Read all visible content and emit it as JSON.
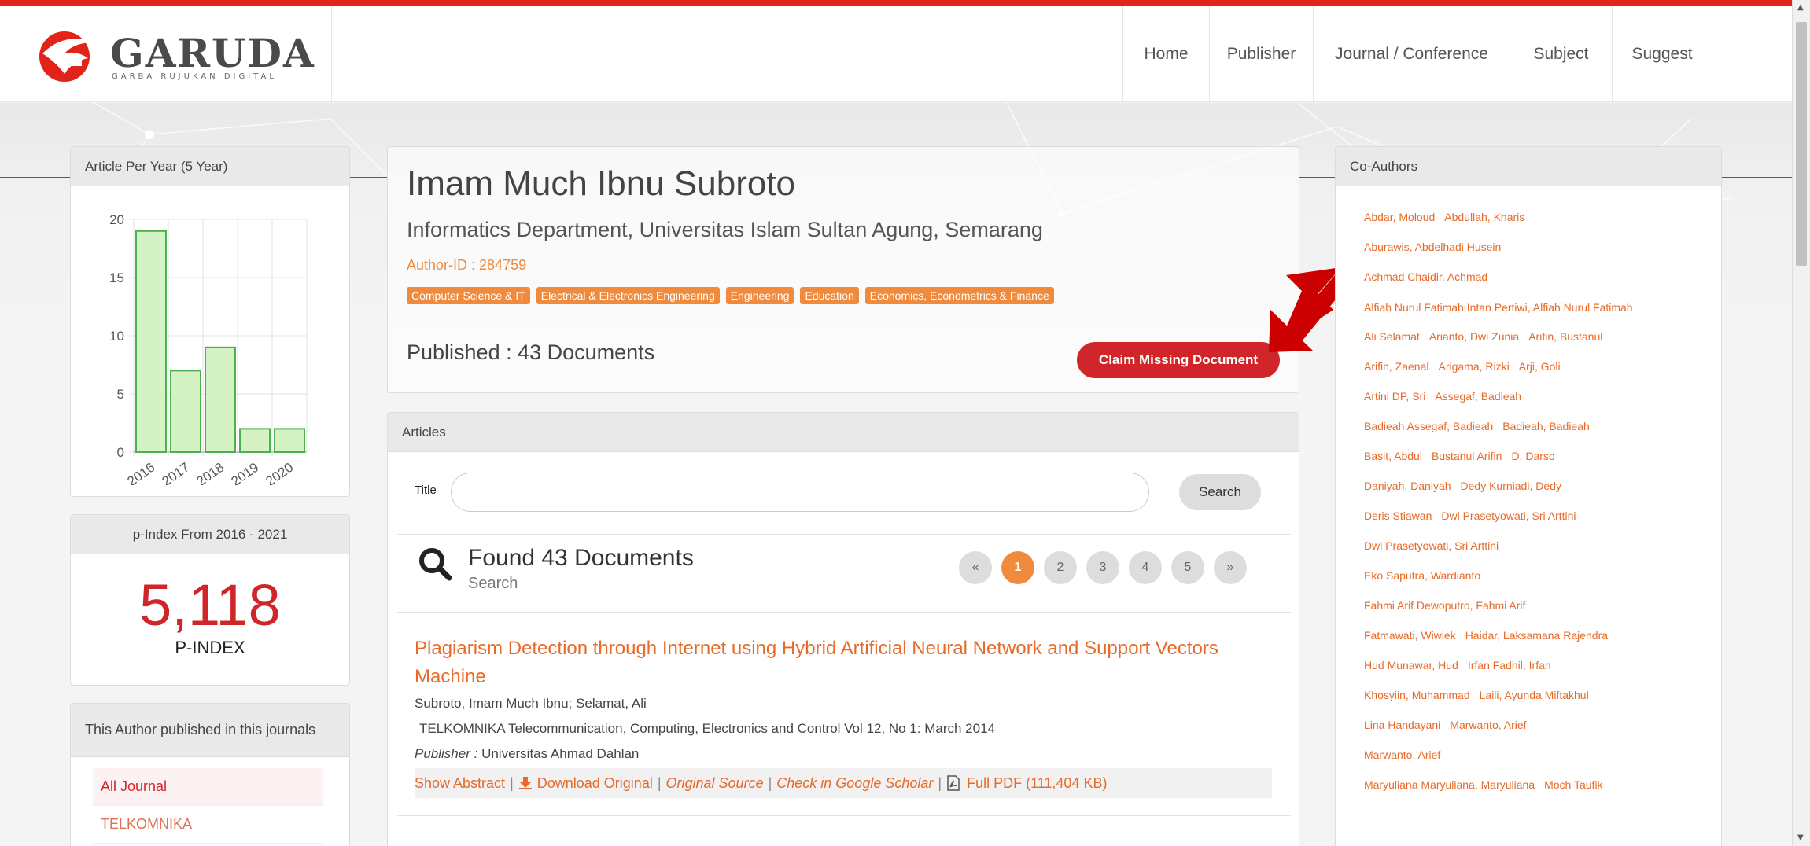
{
  "logo": {
    "text": "GARUDA",
    "subtitle": "GARBA RUJUKAN DIGITAL"
  },
  "nav": [
    {
      "label": "Home"
    },
    {
      "label": "Publisher"
    },
    {
      "label": "Journal / Conference"
    },
    {
      "label": "Subject"
    },
    {
      "label": "Suggest"
    }
  ],
  "colors": {
    "brand_red": "#e2231a",
    "accent_orange": "#f08a3c",
    "link_orange": "#e86a28",
    "bar_fill": "#d4f2c4",
    "bar_stroke": "#4caf50"
  },
  "article_per_year": {
    "title": "Article Per Year (5 Year)",
    "chart_data": {
      "type": "bar",
      "categories": [
        "2016",
        "2017",
        "2018",
        "2019",
        "2020"
      ],
      "values": [
        19,
        7,
        9,
        2,
        2
      ],
      "yticks": [
        "0",
        "5",
        "10",
        "15",
        "20"
      ],
      "ylim": [
        0,
        20
      ],
      "grid": true
    }
  },
  "pindex": {
    "title": "p-Index From 2016 - 2021",
    "value": "5,118",
    "label": "P-INDEX"
  },
  "journals": {
    "title": "This Author published in this journals",
    "items": [
      {
        "label": "All Journal"
      },
      {
        "label": "TELKOMNIKA"
      }
    ]
  },
  "profile": {
    "name": "Imam Much Ibnu Subroto",
    "affiliation": "Informatics Department, Universitas Islam Sultan Agung, Semarang",
    "author_id": "Author-ID : 284759",
    "subjects": [
      "Computer Science & IT",
      "Electrical & Electronics Engineering",
      "Engineering",
      "Education",
      "Economics, Econometrics & Finance"
    ],
    "published": "Published : 43 Documents",
    "claim_button": "Claim Missing Document",
    "arrow_icon": "red-arrow-icon"
  },
  "articles": {
    "title": "Articles",
    "search_label": "Title",
    "search_value": "",
    "search_button": "Search",
    "found_title": "Found 43 Documents",
    "found_sub": "Search",
    "pager": [
      "«",
      "1",
      "2",
      "3",
      "4",
      "5",
      "»"
    ],
    "active_page": "1",
    "first": {
      "title": "Plagiarism Detection through Internet using Hybrid Artificial Neural Network and Support Vectors Machine",
      "authors": "Subroto, Imam Much Ibnu; Selamat, Ali",
      "journal": "TELKOMNIKA Telecommunication, Computing, Electronics and Control  Vol 12, No 1: March 2014",
      "publisher_label": "Publisher :",
      "publisher": "Universitas Ahmad Dahlan",
      "links": {
        "abstract": "Show Abstract",
        "download": "Download Original",
        "source": "Original Source",
        "scholar": "Check in Google Scholar",
        "pdf": "Full PDF (111,404 KB)"
      }
    }
  },
  "coauthors": {
    "title": "Co-Authors",
    "rows": [
      [
        "Abdar, Moloud",
        "Abdullah, Kharis"
      ],
      [
        "Aburawis, Abdelhadi Husein"
      ],
      [
        "Achmad Chaidir, Achmad"
      ],
      [
        "Alfiah Nurul Fatimah Intan Pertiwi, Alfiah Nurul Fatimah"
      ],
      [
        "Ali Selamat",
        "Arianto, Dwi Zunia",
        "Arifin, Bustanul"
      ],
      [
        "Arifin, Zaenal",
        "Arigama, Rizki",
        "Arji, Goli"
      ],
      [
        "Artini DP, Sri",
        "Assegaf, Badieah"
      ],
      [
        "Badieah Assegaf, Badieah",
        "Badieah, Badieah"
      ],
      [
        "Basit, Abdul",
        "Bustanul Arifin",
        "D, Darso"
      ],
      [
        "Daniyah, Daniyah",
        "Dedy Kurniadi, Dedy"
      ],
      [
        "Deris Stiawan",
        "Dwi Prasetyowati, Sri Arttini"
      ],
      [
        "Dwi Prasetyowati, Sri Arttini"
      ],
      [
        "Eko Saputra, Wardianto"
      ],
      [
        "Fahmi Arif Dewoputro, Fahmi Arif"
      ],
      [
        "Fatmawati, Wiwiek",
        "Haidar, Laksamana Rajendra"
      ],
      [
        "Hud Munawar, Hud",
        "Irfan Fadhil, Irfan"
      ],
      [
        "Khosyiin, Muhammad",
        "Laili, Ayunda Miftakhul"
      ],
      [
        "Lina Handayani",
        "Marwanto, Arief"
      ],
      [
        "Marwanto, Arief"
      ],
      [
        "Maryuliana Maryuliana, Maryuliana",
        "Moch Taufik"
      ]
    ]
  }
}
